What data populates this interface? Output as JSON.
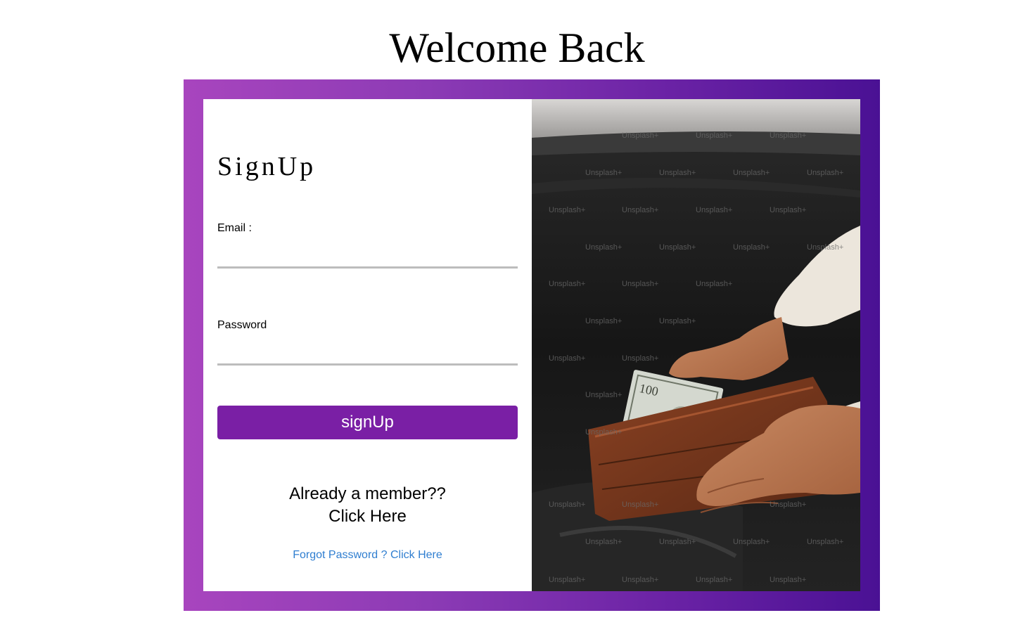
{
  "page": {
    "title": "Welcome Back"
  },
  "form": {
    "heading": "SignUp",
    "email_label": "Email :",
    "email_value": "",
    "password_label": "Password",
    "password_value": "",
    "submit_label": "signUp",
    "member_line1": "Already a member??",
    "member_line2": "Click Here",
    "forgot_label": "Forgot Password ? Click Here"
  },
  "photo": {
    "watermark": "Unsplash+",
    "banknote_text": "100"
  },
  "colors": {
    "button": "#7a1fa5",
    "link": "#2f7ed0",
    "frame_start": "#a845be",
    "frame_end": "#4a1194"
  }
}
